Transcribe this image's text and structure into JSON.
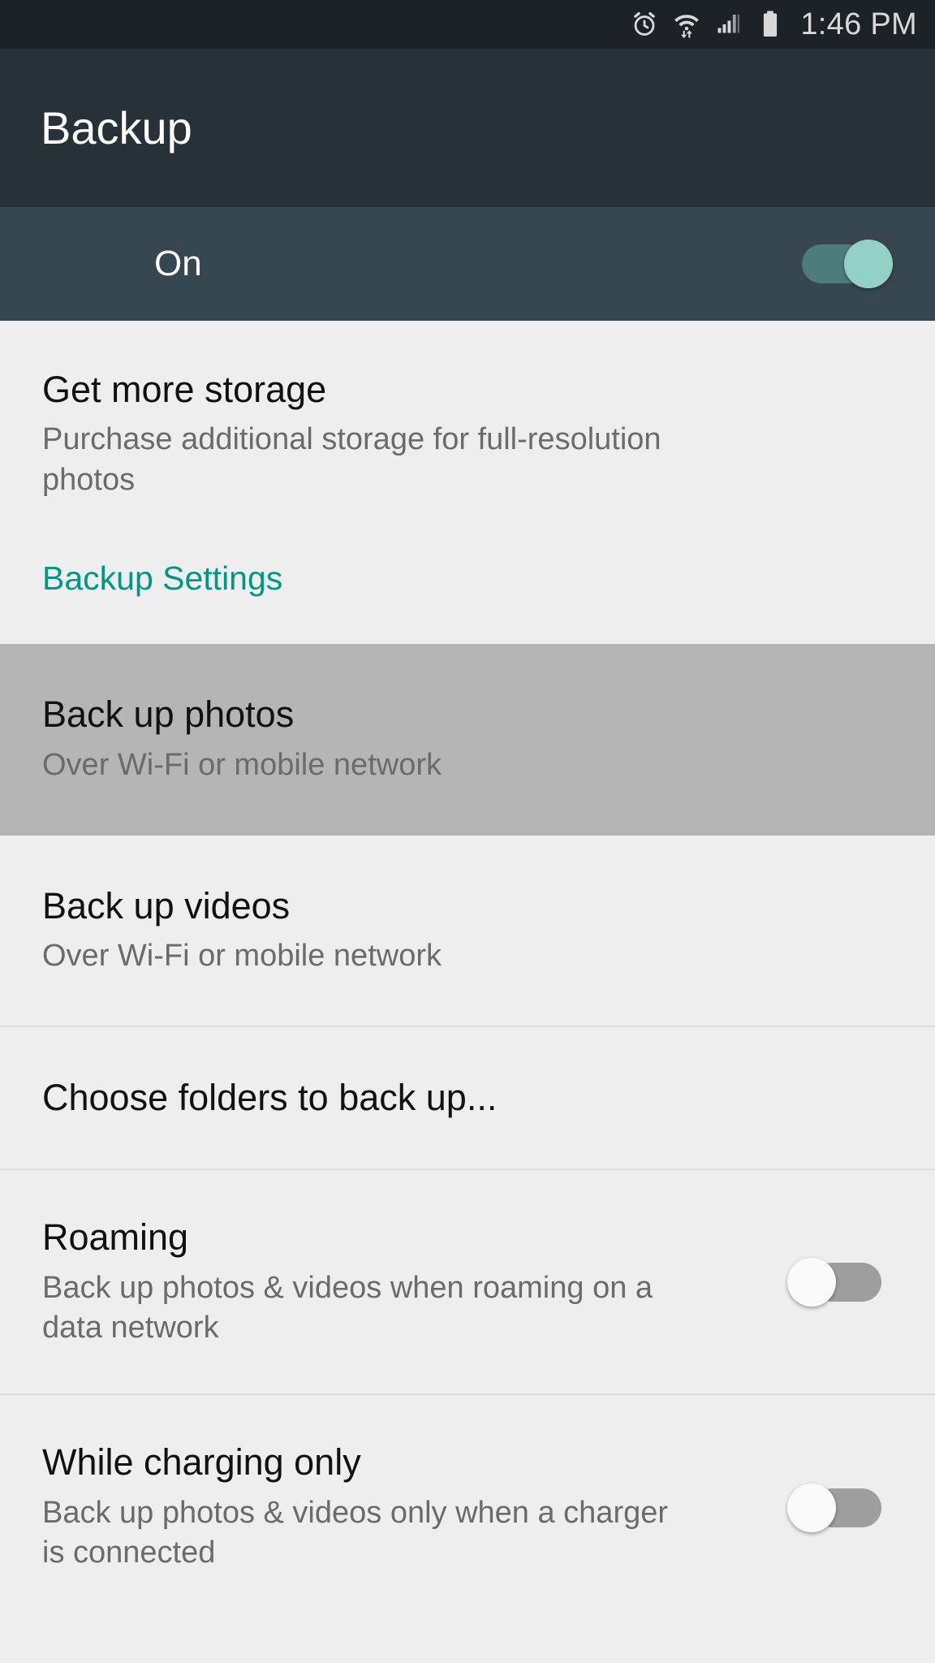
{
  "status_bar": {
    "time": "1:46 PM",
    "icons": [
      "alarm-clock-icon",
      "wifi-data-icon",
      "cellular-signal-icon",
      "battery-full-icon"
    ]
  },
  "app_bar": {
    "title": "Backup"
  },
  "master_switch": {
    "label": "On",
    "state": "on",
    "track_color": "#4C7C7B",
    "knob_color": "#93D1C6"
  },
  "sections": {
    "storage": {
      "title": "Get more storage",
      "subtitle": "Purchase additional storage for full-resolution photos"
    },
    "settings_header": {
      "label": "Backup Settings",
      "color": "#009783"
    },
    "items": [
      {
        "name": "back-up-photos",
        "title": "Back up photos",
        "subtitle": "Over Wi-Fi or mobile network",
        "highlighted": true,
        "has_switch": false
      },
      {
        "name": "back-up-videos",
        "title": "Back up videos",
        "subtitle": "Over Wi-Fi or mobile network",
        "highlighted": false,
        "has_switch": false
      },
      {
        "name": "choose-folders",
        "title": "Choose folders to back up...",
        "subtitle": "",
        "highlighted": false,
        "has_switch": false
      },
      {
        "name": "roaming",
        "title": "Roaming",
        "subtitle": "Back up photos & videos when roaming on a data network",
        "highlighted": false,
        "has_switch": true,
        "switch_state": "off"
      },
      {
        "name": "while-charging-only",
        "title": "While charging only",
        "subtitle": "Back up photos & videos only when a charger is connected",
        "highlighted": false,
        "has_switch": true,
        "switch_state": "off"
      }
    ]
  },
  "theme": {
    "status_bar_bg": "#1C2226",
    "app_bar_bg": "#263238",
    "master_band_bg": "#37474F",
    "content_bg": "#EEEEEE",
    "highlight_bg": "#B5B5B5",
    "accent": "#009783",
    "switch_off_track": "#9E9E9E",
    "switch_off_knob": "#FAFAFA"
  }
}
